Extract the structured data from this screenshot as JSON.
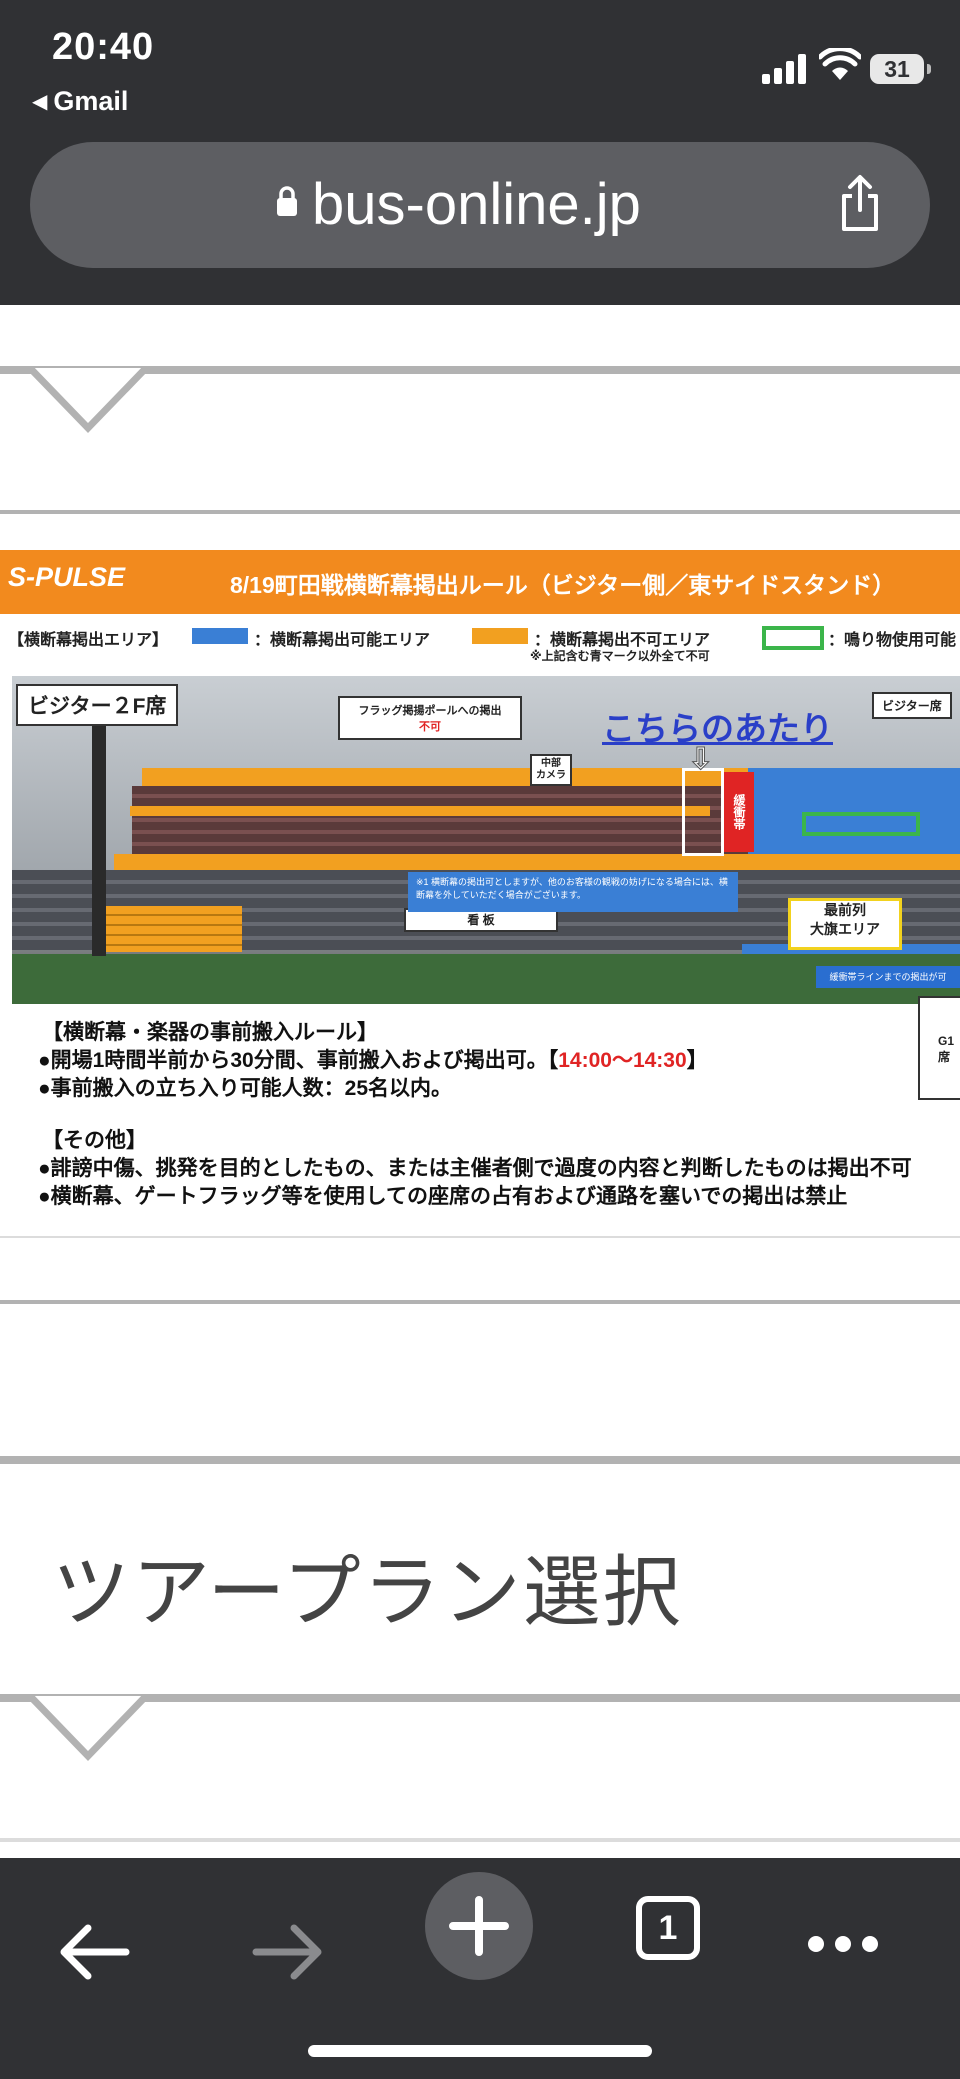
{
  "status_bar": {
    "time": "20:40",
    "back_app": "Gmail",
    "battery": "31"
  },
  "url_bar": {
    "domain": "bus-online.jp"
  },
  "banner": {
    "logo": "S-PULSE",
    "title": "8/19町田戦横断幕掲出ルール（ビジター側／東サイドスタンド）",
    "legend_heading": "【横断幕掲出エリア】",
    "legend_ok": "：横断幕掲出可能エリア",
    "legend_ng": "：横断幕掲出不可エリア",
    "legend_ng_note": "※上記含む青マーク以外全て不可",
    "legend_noise": "：鳴り物使用可能",
    "seat_label": "ビジター２F席",
    "flag_note_line1": "フラッグ掲揚ポールへの掲出",
    "flag_note_line2": "不可",
    "camera_label_line1": "中部",
    "camera_label_line2": "カメラ",
    "highlight": "こちらのあたり",
    "visitor_seat": "ビジター席",
    "buffer": "緩衝帯",
    "front_row_line1": "最前列",
    "front_row_line2": "大旗エリア",
    "board": "看 板",
    "note": "※1 横断幕の掲出可としますが、他のお客様の観戦の妨げになる場合には、横断幕を外していただく場合がございます。",
    "line_note": "緩衝帯ラインまでの掲出が可",
    "g1_line1": "G1",
    "g1_line2": "席",
    "rule_heading": "【横断幕・楽器の事前搬入ルール】",
    "rule_1": "●開場1時間半前から30分間、事前搬入および掲出可。【",
    "rule_1_time": "14:00〜14:30",
    "rule_1_end": "】",
    "rule_2": "●事前搬入の立ち入り可能人数：25名以内。",
    "other_heading": "【その他】",
    "other_1": "●誹謗中傷、挑発を目的としたもの、または主催者側で過度の内容と判断したものは掲出不可",
    "other_2": "●横断幕、ゲートフラッグ等を使用しての座席の占有および通路を塞いでの掲出は禁止"
  },
  "section": {
    "title": "ツアープラン選択"
  },
  "toolbar": {
    "tab_count": "1"
  },
  "colors": {
    "chrome": "#303134",
    "url_pill": "#5d5e62",
    "brand_orange": "#f28a1e",
    "ok_blue": "#3a7fd5",
    "ng_orange": "#f2a020",
    "noise_green": "#3bb54a"
  }
}
